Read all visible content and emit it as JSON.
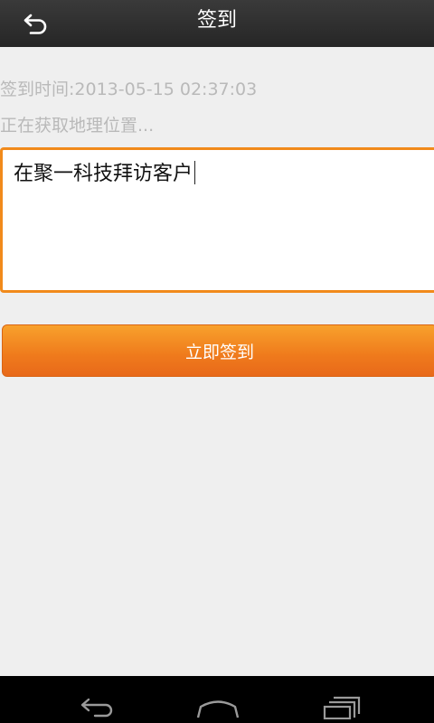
{
  "header": {
    "title": "签到",
    "back_icon": "undo-arrow-icon"
  },
  "info": {
    "checkin_time": "签到时间:2013-05-15 02:37:03",
    "location_status": "正在获取地理位置..."
  },
  "note": {
    "value": "在聚一科技拜访客户"
  },
  "actions": {
    "checkin_label": "立即签到"
  },
  "navbar": {
    "icons": [
      "back-icon",
      "home-icon",
      "recent-apps-icon"
    ]
  },
  "colors": {
    "accent": "#f18a1b",
    "header_bg": "#2e2e2e",
    "page_bg": "#efefef"
  }
}
